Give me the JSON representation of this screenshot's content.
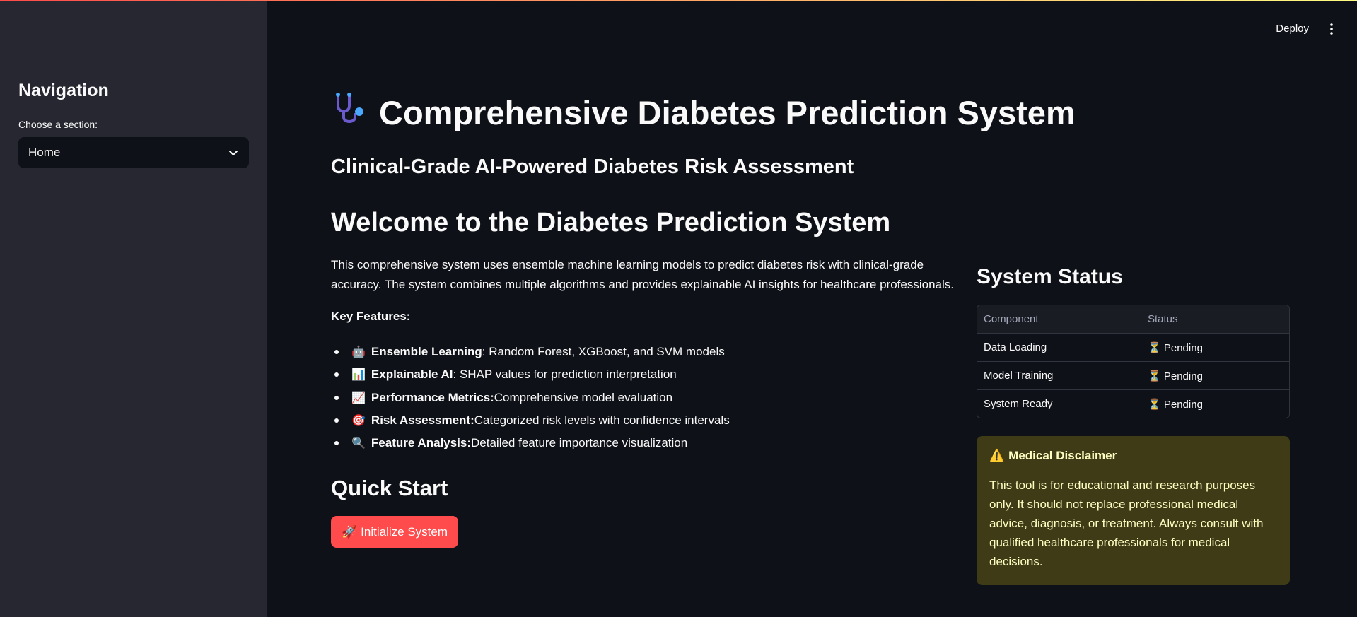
{
  "sidebar": {
    "title": "Navigation",
    "select_label": "Choose a section:",
    "select_value": "Home"
  },
  "toolbar": {
    "deploy_label": "Deploy"
  },
  "main": {
    "title_icon": "🩺",
    "title": "Comprehensive Diabetes Prediction System",
    "subtitle": "Clinical-Grade AI-Powered Diabetes Risk Assessment",
    "welcome_heading": "Welcome to the Diabetes Prediction System",
    "intro": "This comprehensive system uses ensemble machine learning models to predict diabetes risk with clinical-grade accuracy. The system combines multiple algorithms and provides explainable AI insights for healthcare professionals.",
    "features_label": "Key Features:",
    "features": [
      {
        "emoji": "🤖",
        "name": "Ensemble Learning",
        "desc": ": Random Forest, XGBoost, and SVM models"
      },
      {
        "emoji": "📊",
        "name": "Explainable AI",
        "desc": ": SHAP values for prediction interpretation"
      },
      {
        "emoji": "📈",
        "name": "Performance Metrics:",
        "desc": " Comprehensive model evaluation"
      },
      {
        "emoji": "🎯",
        "name": "Risk Assessment:",
        "desc": " Categorized risk levels with confidence intervals"
      },
      {
        "emoji": "🔍",
        "name": "Feature Analysis:",
        "desc": " Detailed feature importance visualization"
      }
    ],
    "quick_start_heading": "Quick Start",
    "init_button_icon": "🚀",
    "init_button_label": "Initialize System"
  },
  "status": {
    "heading": "System Status",
    "columns": [
      "Component",
      "Status"
    ],
    "rows": [
      {
        "component": "Data Loading",
        "icon": "⏳",
        "status": "Pending"
      },
      {
        "component": "Model Training",
        "icon": "⏳",
        "status": "Pending"
      },
      {
        "component": "System Ready",
        "icon": "⏳",
        "status": "Pending"
      }
    ]
  },
  "disclaimer": {
    "icon": "⚠️",
    "title": "Medical Disclaimer",
    "text": "This tool is for educational and research purposes only. It should not replace professional medical advice, diagnosis, or treatment. Always consult with qualified healthcare professionals for medical decisions."
  },
  "colors": {
    "accent": "#ff4b4b",
    "background": "#0e1117",
    "sidebar": "#262730",
    "warning_bg": "#3e3b16",
    "warning_text": "#ffffc2"
  }
}
